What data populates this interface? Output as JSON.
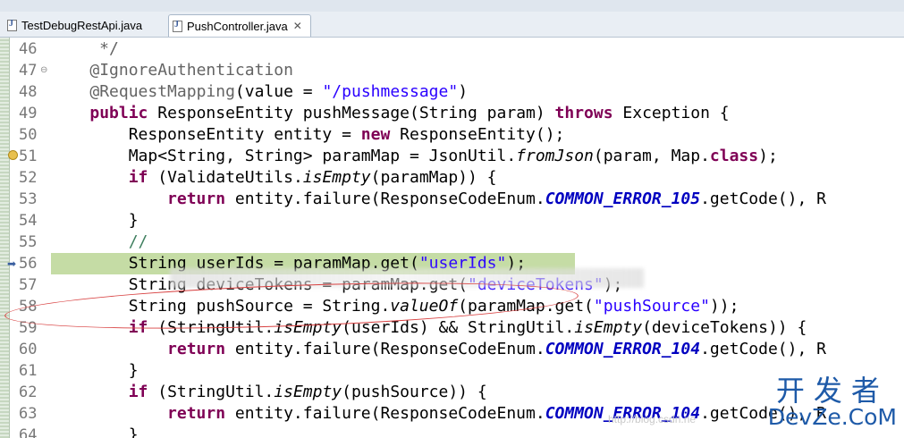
{
  "tabs": [
    {
      "label": "TestDebugRestApi.java",
      "active": false
    },
    {
      "label": "PushController.java",
      "active": true,
      "close": "✕"
    }
  ],
  "editor": {
    "lines": [
      {
        "num": "46",
        "tokens": [
          {
            "t": "     */",
            "c": "an"
          }
        ]
      },
      {
        "num": "47",
        "fold": "⊖",
        "tokens": [
          {
            "t": "    ",
            "c": "t"
          },
          {
            "t": "@IgnoreAuthentication",
            "c": "an"
          }
        ]
      },
      {
        "num": "48",
        "tokens": [
          {
            "t": "    ",
            "c": "t"
          },
          {
            "t": "@RequestMapping",
            "c": "an"
          },
          {
            "t": "(value = ",
            "c": "t"
          },
          {
            "t": "\"/pushmessage\"",
            "c": "s"
          },
          {
            "t": ")",
            "c": "t"
          }
        ]
      },
      {
        "num": "49",
        "tokens": [
          {
            "t": "    ",
            "c": "t"
          },
          {
            "t": "public",
            "c": "k"
          },
          {
            "t": " ResponseEntity pushMessage(String param) ",
            "c": "t"
          },
          {
            "t": "throws",
            "c": "k"
          },
          {
            "t": " Exception {",
            "c": "t"
          }
        ]
      },
      {
        "num": "50",
        "tokens": [
          {
            "t": "        ResponseEntity entity = ",
            "c": "t"
          },
          {
            "t": "new",
            "c": "k"
          },
          {
            "t": " ResponseEntity();",
            "c": "t"
          }
        ]
      },
      {
        "num": "51",
        "marker": "annotation",
        "tokens": [
          {
            "t": "        Map<String, String> paramMap = JsonUtil.",
            "c": "t"
          },
          {
            "t": "fromJson",
            "c": "i"
          },
          {
            "t": "(param, Map.",
            "c": "t"
          },
          {
            "t": "class",
            "c": "k"
          },
          {
            "t": ");",
            "c": "t"
          }
        ]
      },
      {
        "num": "52",
        "tokens": [
          {
            "t": "        ",
            "c": "t"
          },
          {
            "t": "if",
            "c": "k"
          },
          {
            "t": " (ValidateUtils.",
            "c": "t"
          },
          {
            "t": "isEmpty",
            "c": "i"
          },
          {
            "t": "(paramMap)) {",
            "c": "t"
          }
        ]
      },
      {
        "num": "53",
        "tokens": [
          {
            "t": "            ",
            "c": "t"
          },
          {
            "t": "return",
            "c": "k"
          },
          {
            "t": " entity.failure(ResponseCodeEnum.",
            "c": "t"
          },
          {
            "t": "COMMON_ERROR_105",
            "c": "sf"
          },
          {
            "t": ".getCode(), R",
            "c": "t"
          }
        ]
      },
      {
        "num": "54",
        "tokens": [
          {
            "t": "        }",
            "c": "t"
          }
        ]
      },
      {
        "num": "55",
        "tokens": [
          {
            "t": "        //",
            "c": "c"
          }
        ]
      },
      {
        "num": "56",
        "marker": "current",
        "highlight": true,
        "tokens": [
          {
            "t": "        String userIds = paramMap.get(",
            "c": "t"
          },
          {
            "t": "\"userIds\"",
            "c": "s"
          },
          {
            "t": ");",
            "c": "t"
          }
        ]
      },
      {
        "num": "57",
        "tokens": [
          {
            "t": "        String deviceTokens = paramMap.get(",
            "c": "t"
          },
          {
            "t": "\"deviceTokens\"",
            "c": "s"
          },
          {
            "t": ");",
            "c": "t"
          }
        ]
      },
      {
        "num": "58",
        "tokens": [
          {
            "t": "        String pushSource = String.",
            "c": "t"
          },
          {
            "t": "valueOf",
            "c": "i"
          },
          {
            "t": "(paramMap.get(",
            "c": "t"
          },
          {
            "t": "\"pushSource\"",
            "c": "s"
          },
          {
            "t": "));",
            "c": "t"
          }
        ]
      },
      {
        "num": "59",
        "tokens": [
          {
            "t": "        ",
            "c": "t"
          },
          {
            "t": "if",
            "c": "k"
          },
          {
            "t": " (StringUtil.",
            "c": "t"
          },
          {
            "t": "isEmpty",
            "c": "i"
          },
          {
            "t": "(userIds) && StringUtil.",
            "c": "t"
          },
          {
            "t": "isEmpty",
            "c": "i"
          },
          {
            "t": "(deviceTokens)) {",
            "c": "t"
          }
        ]
      },
      {
        "num": "60",
        "tokens": [
          {
            "t": "            ",
            "c": "t"
          },
          {
            "t": "return",
            "c": "k"
          },
          {
            "t": " entity.failure(ResponseCodeEnum.",
            "c": "t"
          },
          {
            "t": "COMMON_ERROR_104",
            "c": "sf"
          },
          {
            "t": ".getCode(), R",
            "c": "t"
          }
        ]
      },
      {
        "num": "61",
        "tokens": [
          {
            "t": "        }",
            "c": "t"
          }
        ]
      },
      {
        "num": "62",
        "tokens": [
          {
            "t": "        ",
            "c": "t"
          },
          {
            "t": "if",
            "c": "k"
          },
          {
            "t": " (StringUtil.",
            "c": "t"
          },
          {
            "t": "isEmpty",
            "c": "i"
          },
          {
            "t": "(pushSource)) {",
            "c": "t"
          }
        ]
      },
      {
        "num": "63",
        "tokens": [
          {
            "t": "            ",
            "c": "t"
          },
          {
            "t": "return",
            "c": "k"
          },
          {
            "t": " entity.failure(ResponseCodeEnum.",
            "c": "t"
          },
          {
            "t": "COMMON_ERROR_104",
            "c": "sf"
          },
          {
            "t": ".getCode(), R",
            "c": "t"
          }
        ]
      },
      {
        "num": "64",
        "tokens": [
          {
            "t": "        }",
            "c": "t"
          }
        ]
      }
    ]
  },
  "watermark": {
    "chinese": "开发者",
    "english": "DevZe.CoM",
    "url": "http://blog.csdn.ne"
  }
}
